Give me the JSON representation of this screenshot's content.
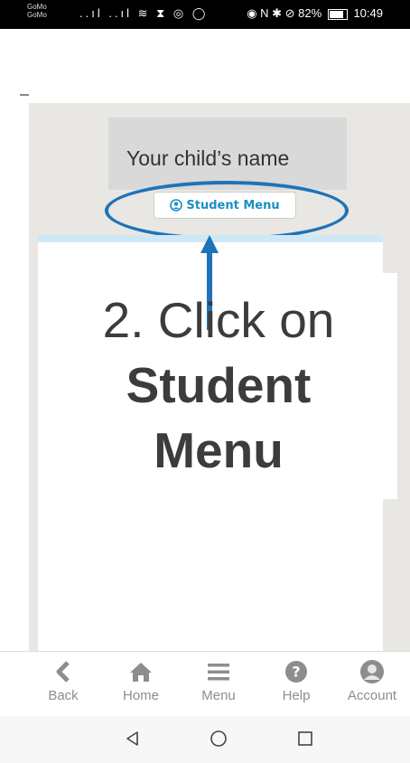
{
  "status_bar": {
    "carrier_1": "GoMo",
    "carrier_2": "GoMo",
    "left_icons": "..ıl ..ıl ≋ ⧗ ◎ ◯",
    "right_icons": "◉ N ✱ ⊘",
    "battery_percent": "82%",
    "time": "10:49"
  },
  "child_name": "Your child’s name",
  "student_menu_button": {
    "label": "Student Menu"
  },
  "instruction": {
    "line1": "2. Click on",
    "line2": "Student",
    "line3": "Menu"
  },
  "bottom_nav": {
    "items": [
      {
        "label": "Back",
        "icon": "chevron-left-icon"
      },
      {
        "label": "Home",
        "icon": "home-icon"
      },
      {
        "label": "Menu",
        "icon": "hamburger-icon"
      },
      {
        "label": "Help",
        "icon": "help-icon"
      },
      {
        "label": "Account",
        "icon": "account-icon"
      }
    ]
  },
  "colors": {
    "accent_blue": "#1e73b8",
    "button_text": "#1b8fc6",
    "panel_gray": "#e8e7e3",
    "nav_gray": "#8d8d8d"
  }
}
